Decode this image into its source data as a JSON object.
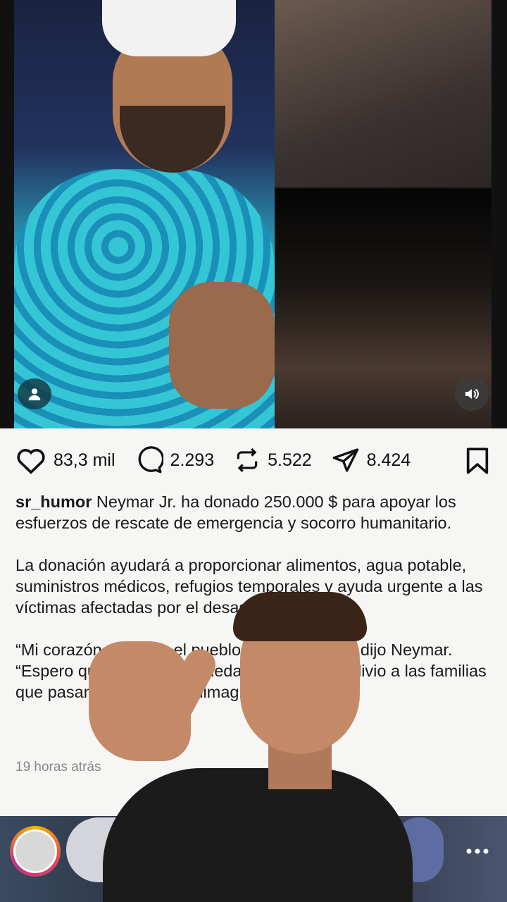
{
  "post": {
    "likes": "83,3 mil",
    "comments": "2.293",
    "reposts": "5.522",
    "shares": "8.424",
    "username": "sr_humor",
    "caption_intro": "Neymar Jr. ha donado 250.000 $ para apoyar los esfuerzos de rescate de emergencia y socorro humanitario.",
    "paragraph_2": "La donación ayudará a proporcionar alimentos, agua potable, suministros médicos, refugios temporales y ayuda urgente a las víctimas afectadas por el desastre.",
    "paragraph_3": "“Mi corazón está con el pueblo de Venezuela”, dijo Neymar. “Espero que este apoyo pueda traer fuerza y alivio a las familias que pasan por un dolor inimaginable.”",
    "timestamp": "19 horas atrás"
  },
  "icons": {
    "like": "heart-icon",
    "comment": "comment-icon",
    "repost": "repost-icon",
    "share": "send-icon",
    "save": "bookmark-icon",
    "user_tag": "person-icon",
    "sound": "speaker-icon",
    "more": "more-icon"
  }
}
